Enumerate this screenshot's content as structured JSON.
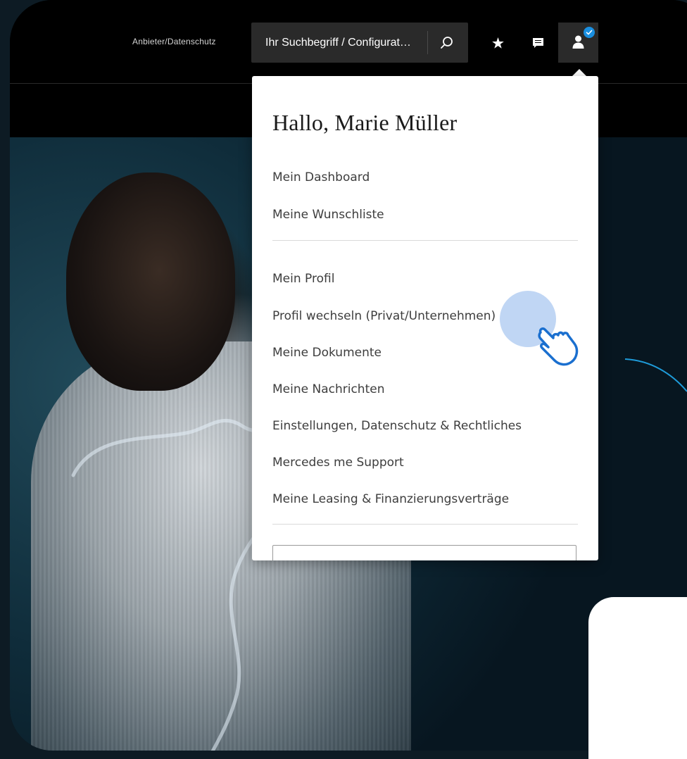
{
  "header": {
    "provider_link": "Anbieter/Datenschutz",
    "search": {
      "placeholder": "Ihr Suchbegriff / Configurat…"
    },
    "icons": [
      "search-icon",
      "star-icon",
      "message-icon",
      "user-icon",
      "check-badge-icon"
    ]
  },
  "account_menu": {
    "greeting": "Hallo, Marie Müller",
    "group1": [
      "Mein Dashboard",
      "Meine Wunschliste"
    ],
    "group2": [
      "Mein Profil",
      "Profil wechseln (Privat/Unternehmen)",
      "Meine Dokumente",
      "Meine Nachrichten",
      "Einstellungen, Datenschutz & Rechtliches",
      "Mercedes me Support",
      "Meine Leasing & Finanzierungsverträge"
    ]
  },
  "colors": {
    "accent": "#1a8fe0",
    "header_bg": "#000000",
    "menu_text": "#3d3d3d"
  }
}
